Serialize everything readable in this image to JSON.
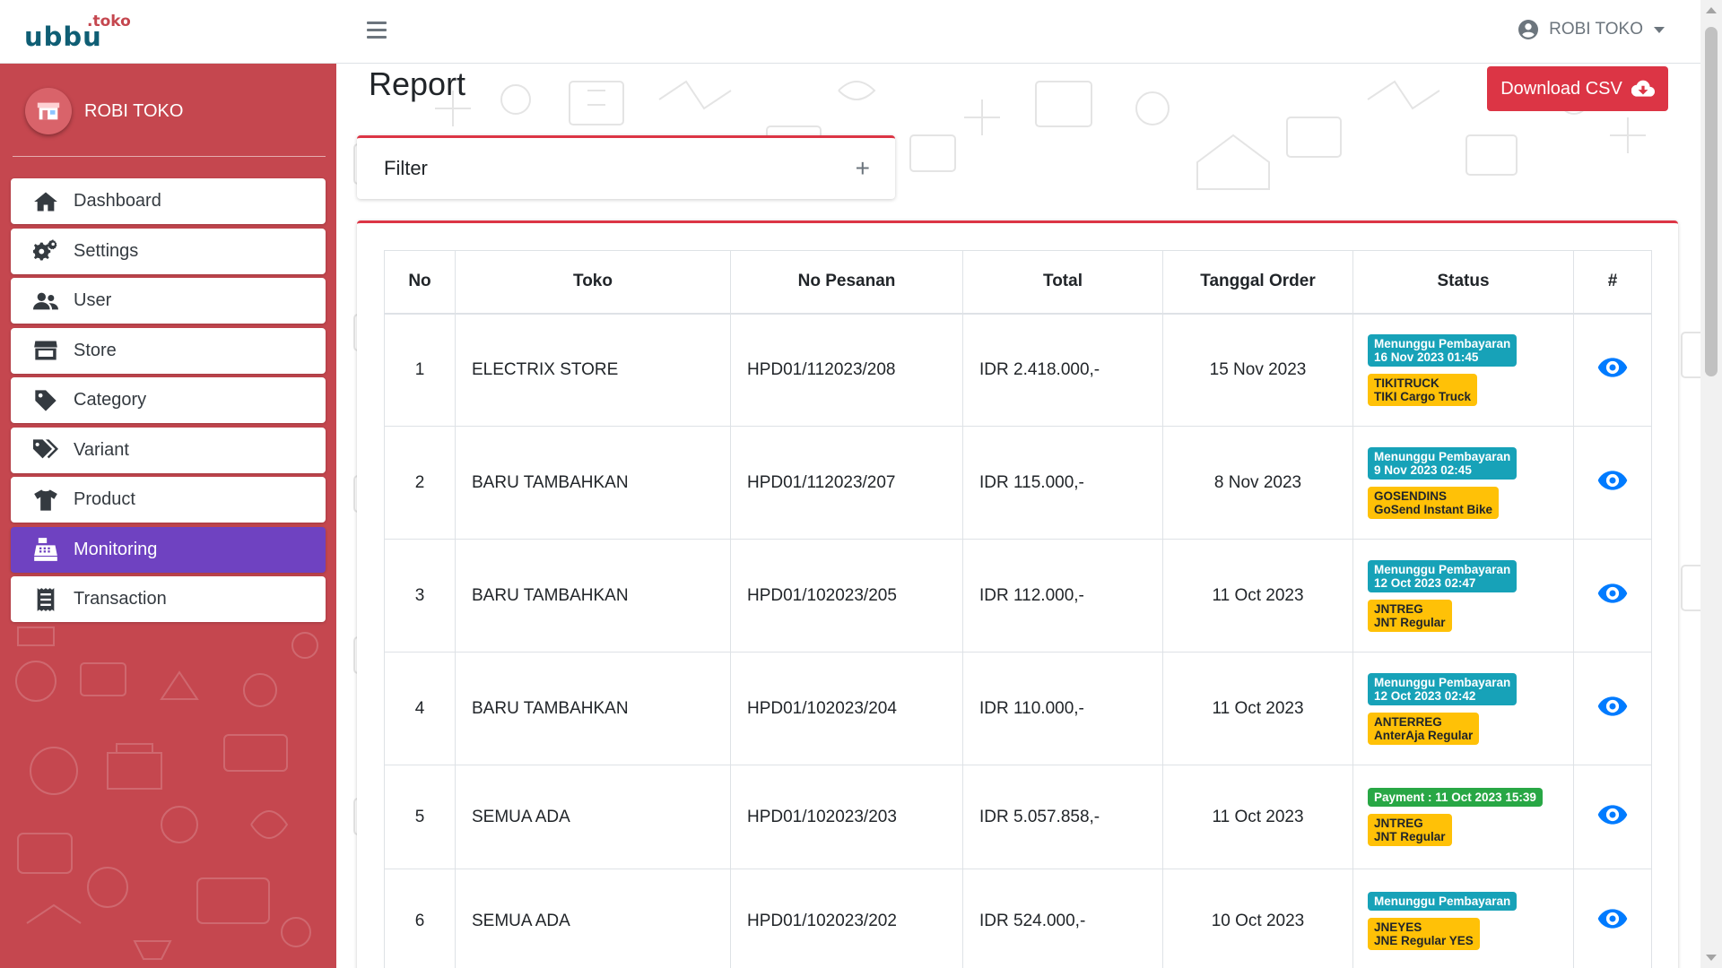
{
  "brand": {
    "main": "ubbu",
    "sup": ".toko"
  },
  "sidebar": {
    "user_name": "ROBI TOKO",
    "items": [
      {
        "label": "Dashboard",
        "icon": "home-icon",
        "active": false
      },
      {
        "label": "Settings",
        "icon": "cogs-icon",
        "active": false
      },
      {
        "label": "User",
        "icon": "users-icon",
        "active": false
      },
      {
        "label": "Store",
        "icon": "store-icon",
        "active": false
      },
      {
        "label": "Category",
        "icon": "tag-icon",
        "active": false
      },
      {
        "label": "Variant",
        "icon": "tags-icon",
        "active": false
      },
      {
        "label": "Product",
        "icon": "tshirt-icon",
        "active": false
      },
      {
        "label": "Monitoring",
        "icon": "cash-register-icon",
        "active": true
      },
      {
        "label": "Transaction",
        "icon": "receipt-icon",
        "active": false
      }
    ]
  },
  "topbar": {
    "user_label": "ROBI TOKO"
  },
  "page": {
    "title": "Report",
    "download_label": "Download CSV",
    "filter_label": "Filter",
    "filter_toggle": "+"
  },
  "table": {
    "headers": [
      "No",
      "Toko",
      "No Pesanan",
      "Total",
      "Tanggal Order",
      "Status",
      "#"
    ],
    "rows": [
      {
        "no": "1",
        "toko": "ELECTRIX STORE",
        "pesanan": "HPD01/112023/208",
        "total": "IDR 2.418.000,-",
        "tanggal": "15 Nov 2023",
        "status": {
          "type": "info",
          "line1": "Menunggu Pembayaran",
          "line2": "16 Nov 2023 01:45"
        },
        "courier": {
          "line1": "TIKITRUCK",
          "line2": "TIKI Cargo Truck"
        }
      },
      {
        "no": "2",
        "toko": "BARU TAMBAHKAN",
        "pesanan": "HPD01/112023/207",
        "total": "IDR 115.000,-",
        "tanggal": "8 Nov 2023",
        "status": {
          "type": "info",
          "line1": "Menunggu Pembayaran",
          "line2": "9 Nov 2023 02:45"
        },
        "courier": {
          "line1": "GOSENDINS",
          "line2": "GoSend Instant Bike"
        }
      },
      {
        "no": "3",
        "toko": "BARU TAMBAHKAN",
        "pesanan": "HPD01/102023/205",
        "total": "IDR 112.000,-",
        "tanggal": "11 Oct 2023",
        "status": {
          "type": "info",
          "line1": "Menunggu Pembayaran",
          "line2": "12 Oct 2023 02:47"
        },
        "courier": {
          "line1": "JNTREG",
          "line2": "JNT Regular"
        }
      },
      {
        "no": "4",
        "toko": "BARU TAMBAHKAN",
        "pesanan": "HPD01/102023/204",
        "total": "IDR 110.000,-",
        "tanggal": "11 Oct 2023",
        "status": {
          "type": "info",
          "line1": "Menunggu Pembayaran",
          "line2": "12 Oct 2023 02:42"
        },
        "courier": {
          "line1": "ANTERREG",
          "line2": "AnterAja Regular"
        }
      },
      {
        "no": "5",
        "toko": "SEMUA ADA",
        "pesanan": "HPD01/102023/203",
        "total": "IDR 5.057.858,-",
        "tanggal": "11 Oct 2023",
        "status": {
          "type": "success",
          "line1": "Payment : 11 Oct 2023 15:39",
          "line2": ""
        },
        "courier": {
          "line1": "JNTREG",
          "line2": "JNT Regular"
        }
      },
      {
        "no": "6",
        "toko": "SEMUA ADA",
        "pesanan": "HPD01/102023/202",
        "total": "IDR 524.000,-",
        "tanggal": "10 Oct 2023",
        "status": {
          "type": "info",
          "line1": "Menunggu Pembayaran",
          "line2": ""
        },
        "courier": {
          "line1": "JNEYES",
          "line2": "JNE Regular YES"
        }
      }
    ]
  },
  "colors": {
    "sidebar": "#c5474f",
    "active": "#6f42c1",
    "danger": "#dc3545",
    "info": "#17a2b8",
    "warning": "#ffc107",
    "success": "#28a745",
    "link": "#007bff"
  }
}
